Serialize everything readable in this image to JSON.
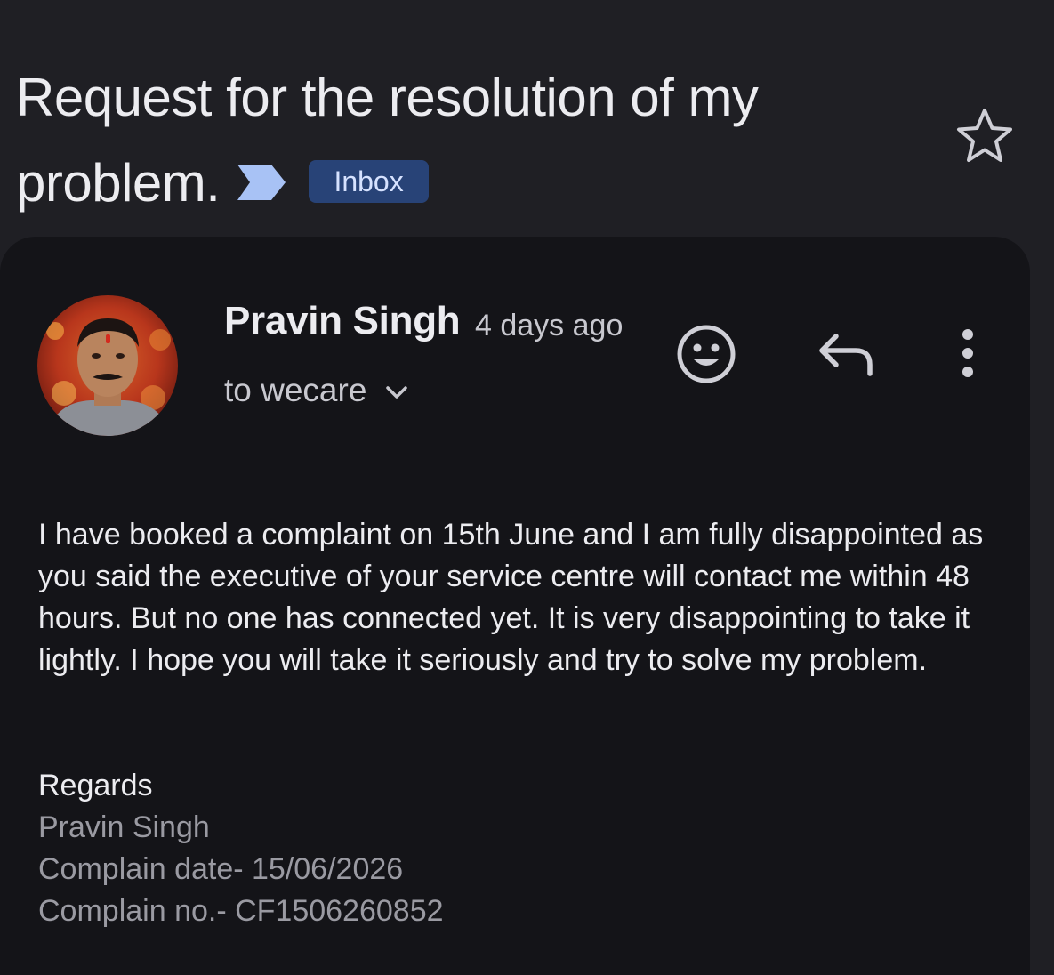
{
  "email": {
    "subject": "Request for the resolution of my problem.",
    "label": "Inbox",
    "sender_name": "Pravin Singh",
    "sent_time": "4 days ago",
    "recipients": "to wecare",
    "body": "I have booked a complaint on 15th June and I am fully disappointed as you said the executive of your service centre will contact me within 48 hours. But no one has connected yet. It is very disappointing to take it lightly. I hope you will take it seriously and try to solve my problem.",
    "closing": "Regards",
    "signature": {
      "name": "Pravin Singh",
      "date_line": "Complain date- 15/06/2026",
      "number_line": "Complain no.- CF1506260852"
    }
  },
  "icons": {
    "importance_marker": "importance-marker-icon",
    "star": "star-icon",
    "reaction": "add-reaction-icon",
    "reply": "reply-icon",
    "more": "more-vert-icon",
    "expand": "chevron-down-icon"
  },
  "colors": {
    "background": "#1f1f24",
    "card": "#141418",
    "label_chip": "#284377",
    "label_text": "#d6e2ff",
    "importance_marker": "#a8c2f5",
    "muted_text": "#9a9aa2"
  }
}
